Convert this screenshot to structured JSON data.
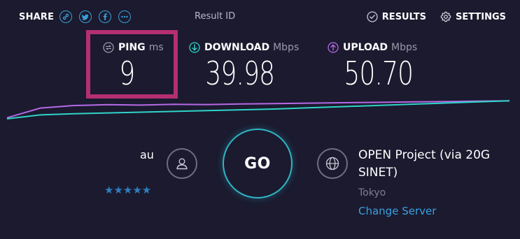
{
  "header": {
    "share_label": "SHARE",
    "share_buttons": [
      {
        "icon": "link-icon"
      },
      {
        "icon": "twitter-icon"
      },
      {
        "icon": "facebook-icon"
      },
      {
        "icon": "more-icon"
      }
    ],
    "result_id_label": "Result ID",
    "results_label": "RESULTS",
    "settings_label": "SETTINGS"
  },
  "metrics": {
    "ping": {
      "label": "PING",
      "unit": "ms",
      "value": "9",
      "icon": "ping-icon",
      "color": "#9a9aab"
    },
    "download": {
      "label": "DOWNLOAD",
      "unit": "Mbps",
      "value": "39.98",
      "icon": "download-arrow-icon",
      "color": "#2fd4c7"
    },
    "upload": {
      "label": "UPLOAD",
      "unit": "Mbps",
      "value": "50.70",
      "icon": "upload-arrow-icon",
      "color": "#b569e6"
    }
  },
  "chart_data": {
    "type": "line",
    "series": [
      {
        "color": "#b569e6",
        "values": [
          0.05,
          0.55,
          0.68,
          0.72,
          0.7,
          0.74,
          0.73,
          0.76,
          0.78,
          0.8,
          0.82,
          0.84,
          0.86,
          0.88,
          0.9,
          0.92
        ]
      },
      {
        "color": "#2fd4c7",
        "values": [
          0.0,
          0.2,
          0.26,
          0.3,
          0.34,
          0.38,
          0.42,
          0.46,
          0.5,
          0.56,
          0.62,
          0.68,
          0.74,
          0.8,
          0.86,
          0.92
        ]
      }
    ]
  },
  "provider": {
    "name": "au",
    "rating_stars": "★★★★★"
  },
  "go_label": "GO",
  "server": {
    "name": "OPEN Project (via 20G SINET)",
    "location": "Tokyo",
    "change_label": "Change Server"
  },
  "colors": {
    "background": "#1b1a2f",
    "accent_blue": "#3aa0e0",
    "go_ring": "#2fb7c6",
    "highlight": "#b42f72"
  }
}
